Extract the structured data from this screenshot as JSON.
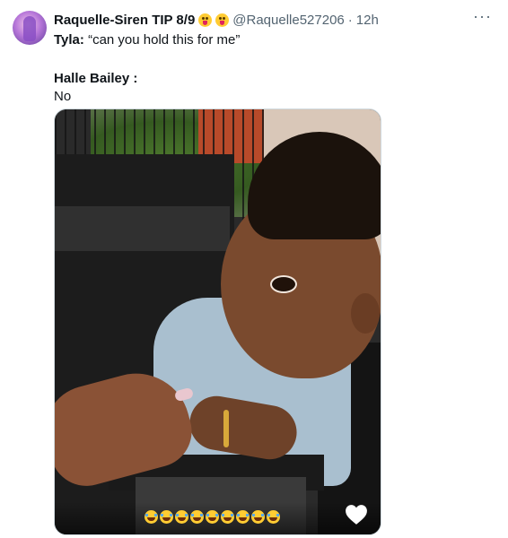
{
  "tweet": {
    "display_name": "Raquelle-Siren TIP 8/9",
    "name_emojis": [
      "tongue-emoji",
      "tongue-emoji"
    ],
    "handle": "@Raquelle527206",
    "separator": "·",
    "time": "12h",
    "more_icon": "more-horizontal-icon",
    "lines": [
      {
        "speaker": "Tyla:",
        "text": "“can you hold this for me”"
      },
      {
        "speaker": "Halle Bailey :",
        "text": "No"
      }
    ]
  },
  "media": {
    "overlay_emojis": [
      "laugh-cry",
      "laugh-cry",
      "laugh-cry",
      "laugh-cry",
      "laugh-cry",
      "laugh-cry",
      "laugh-cry",
      "laugh-cry",
      "laugh-cry"
    ],
    "heart_icon": "heart-icon",
    "heart_color": "#ffffff"
  },
  "colors": {
    "text": "#0f1419",
    "secondary": "#536471",
    "border": "#cfd9de"
  }
}
